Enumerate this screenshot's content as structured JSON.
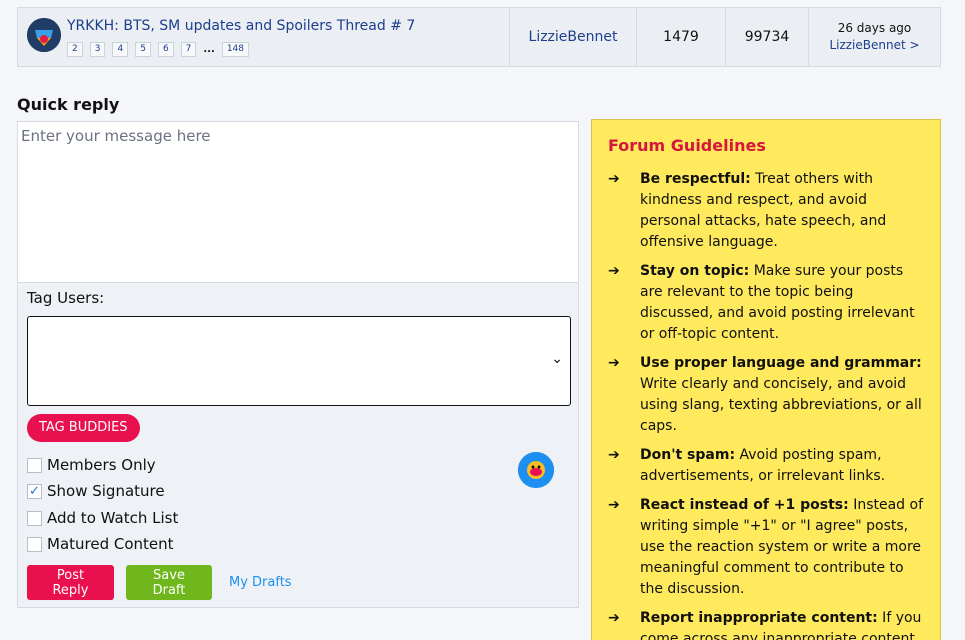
{
  "thread": {
    "title": "YRKKH: BTS, SM updates and Spoilers Thread # 7",
    "pages": [
      "2",
      "3",
      "4",
      "5",
      "6",
      "7"
    ],
    "ellipsis": "...",
    "last_page": "148",
    "author": "LizzieBennet",
    "replies": "1479",
    "views": "99734",
    "last_post_time": "26 days ago",
    "last_post_by": "LizzieBennet >"
  },
  "quick_reply": {
    "heading": "Quick reply",
    "message_placeholder": "Enter your message here",
    "tag_label": "Tag Users:",
    "tag_buddies": "TAG BUDDIES",
    "options": [
      {
        "label": "Members Only",
        "checked": false
      },
      {
        "label": "Show Signature",
        "checked": true
      },
      {
        "label": "Add to Watch List",
        "checked": false
      },
      {
        "label": "Matured Content",
        "checked": false
      }
    ],
    "post_reply": "Post Reply",
    "save_draft": "Save Draft",
    "my_drafts": "My Drafts"
  },
  "guidelines": {
    "title": "Forum Guidelines",
    "arrow": "➔",
    "items": [
      {
        "bold": "Be respectful:",
        "text": " Treat others with kindness and respect, and avoid personal attacks, hate speech, and offensive language."
      },
      {
        "bold": "Stay on topic:",
        "text": " Make sure your posts are relevant to the topic being discussed, and avoid posting irrelevant or off-topic content."
      },
      {
        "bold": "Use proper language and grammar:",
        "text": " Write clearly and concisely, and avoid using slang, texting abbreviations, or all caps."
      },
      {
        "bold": "Don't spam:",
        "text": " Avoid posting spam, advertisements, or irrelevant links."
      },
      {
        "bold": "React instead of +1 posts:",
        "text": " Instead of writing simple \"+1\" or \"I agree\" posts, use the reaction system or write a more meaningful comment to contribute to the discussion."
      },
      {
        "bold": "Report inappropriate content:",
        "text": " If you come across any inappropriate content, report it to the moderators."
      }
    ]
  },
  "colors": {
    "accent_red": "#e8104e",
    "accent_green": "#6fb71d",
    "link_blue": "#1c3f8c",
    "guide_bg": "#ffe95c"
  }
}
